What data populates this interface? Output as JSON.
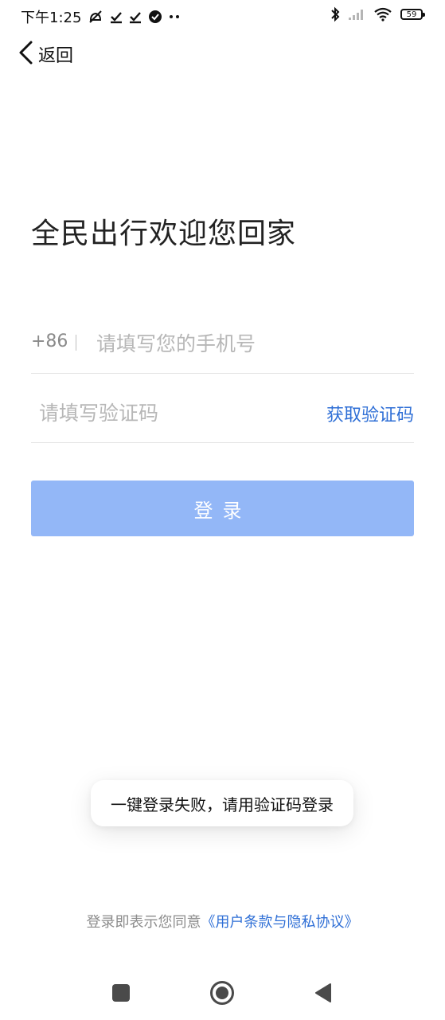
{
  "status_bar": {
    "time": "下午1:25",
    "battery": "59"
  },
  "header": {
    "back_label": "返回"
  },
  "main": {
    "title": "全民出行欢迎您回家",
    "phone": {
      "country_code": "+86",
      "placeholder": "请填写您的手机号",
      "value": ""
    },
    "code": {
      "placeholder": "请填写验证码",
      "value": "",
      "get_code_label": "获取验证码"
    },
    "login_label": "登录"
  },
  "toast": {
    "message": "一键登录失败，请用验证码登录"
  },
  "footer": {
    "agreement_prefix": "登录即表示您同意",
    "agreement_link": "《用户条款与隐私协议》"
  },
  "colors": {
    "accent": "#2f6fd6",
    "button_disabled": "#93b7f7"
  },
  "icons": {
    "back": "chevron-left-icon",
    "bluetooth": "bluetooth-icon",
    "signal": "signal-icon",
    "wifi": "wifi-icon",
    "nav_recent": "square-icon",
    "nav_home": "circle-icon",
    "nav_back": "triangle-left-icon"
  }
}
